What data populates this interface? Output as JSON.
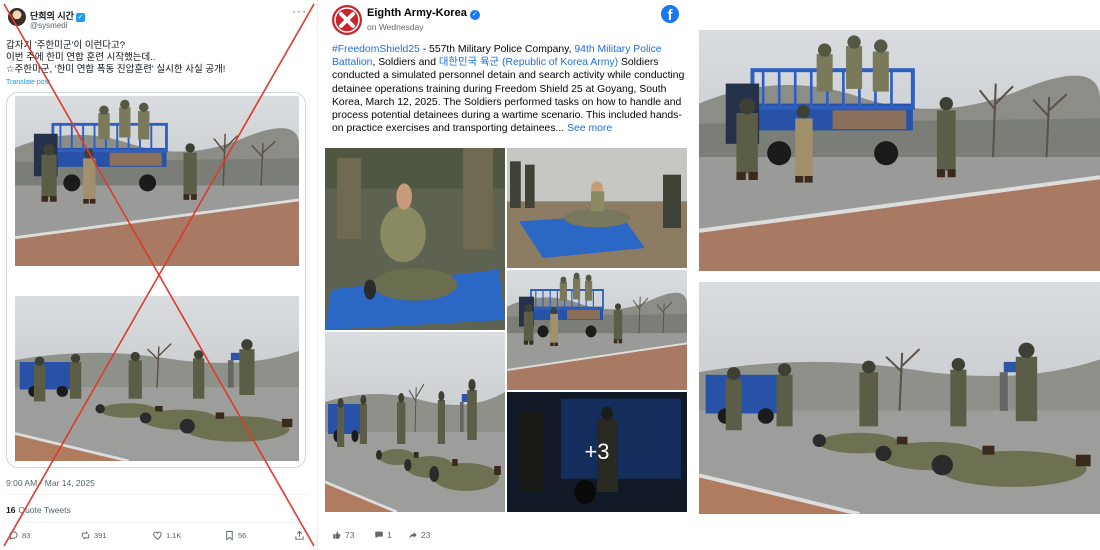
{
  "tweet": {
    "display_name": "단희의 시간",
    "handle": "@sysmedi",
    "more_label": "···",
    "lines": [
      "갑자기 '주한미군'이 이런다고?",
      "이번 주에 한미 연합 훈련 시작했는데..",
      "☆주한미군, '한미 연합 폭동 진압훈련' 실시한 사실 공개!"
    ],
    "translate_label": "Translate post",
    "timestamp": "9:00 AM · Mar 14, 2025",
    "quote_count": "16",
    "quote_label": "Quote Tweets",
    "actions": {
      "replies": "83",
      "retweets": "391",
      "likes": "1.1K",
      "bookmarks": "56"
    }
  },
  "facebook": {
    "page_name": "Eighth Army-Korea",
    "posted": "on Wednesday",
    "brand_glyph": "f",
    "hashtag": "#FreedomShield25",
    "post_part1": " - 557th Military Police Company, ",
    "unit_link": "94th Military Police",
    "unit_link_2": "Battalion",
    "post_part2": ", Soldiers and ",
    "rok_link": "대한민국 육군 (Republic of Korea Army)",
    "post_part3": " Soldiers",
    "lines": [
      "conducted a simulated personnel detain and search activity while conducting",
      "detainee operations training during Freedom Shield 25 at Goyang, South",
      "Korea, March 12, 2025. The Soldiers performed tasks on how to handle and",
      "process potential detainees during a wartime scenario. This included hands-",
      "on practice exercises and transporting detainees..."
    ],
    "see_more": "See more",
    "extra_photos": "+3",
    "reactions": {
      "likes": "73",
      "comments": "1",
      "shares": "23"
    }
  },
  "colors": {
    "twitter_blue": "#1d9bf0",
    "facebook_blue": "#1877f2",
    "link_blue": "#216fdb",
    "cross_red": "#e0392b",
    "truck_blue": "#2752a8",
    "camo": "#6d7152"
  }
}
